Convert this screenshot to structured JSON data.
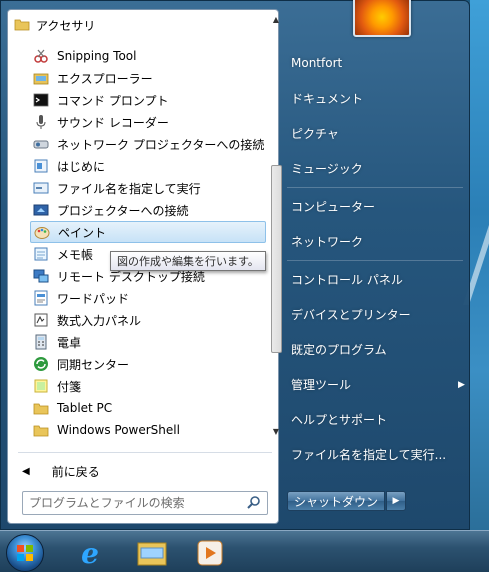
{
  "start_menu": {
    "folder_label": "アクセサリ",
    "programs": [
      {
        "label": "Snipping Tool",
        "icon": "snipping-tool-icon"
      },
      {
        "label": "エクスプローラー",
        "icon": "explorer-folder-icon"
      },
      {
        "label": "コマンド プロンプト",
        "icon": "command-prompt-icon"
      },
      {
        "label": "サウンド レコーダー",
        "icon": "microphone-icon"
      },
      {
        "label": "ネットワーク プロジェクターへの接続",
        "icon": "network-projector-icon"
      },
      {
        "label": "はじめに",
        "icon": "getting-started-icon"
      },
      {
        "label": "ファイル名を指定して実行",
        "icon": "run-icon"
      },
      {
        "label": "プロジェクターへの接続",
        "icon": "projector-icon"
      },
      {
        "label": "ペイント",
        "icon": "paint-icon"
      },
      {
        "label": "メモ帳",
        "icon": "notepad-icon"
      },
      {
        "label": "リモート デスクトップ接続",
        "icon": "remote-desktop-icon"
      },
      {
        "label": "ワードパッド",
        "icon": "wordpad-icon"
      },
      {
        "label": "数式入力パネル",
        "icon": "math-input-icon"
      },
      {
        "label": "電卓",
        "icon": "calculator-icon"
      },
      {
        "label": "同期センター",
        "icon": "sync-center-icon"
      },
      {
        "label": "付箋",
        "icon": "sticky-notes-icon"
      }
    ],
    "subfolders": [
      {
        "label": "Tablet PC",
        "icon": "folder-icon"
      },
      {
        "label": "Windows PowerShell",
        "icon": "folder-icon"
      }
    ],
    "selected_item": "ペイント",
    "tooltip": "図の作成や編集を行います。",
    "back_label": "前に戻る",
    "search_placeholder": "プログラムとファイルの検索"
  },
  "right_panel": {
    "items": [
      {
        "label": "Montfort"
      },
      {
        "label": "ドキュメント"
      },
      {
        "label": "ピクチャ"
      },
      {
        "label": "ミュージック"
      },
      {
        "label": "コンピューター"
      },
      {
        "label": "ネットワーク"
      },
      {
        "label": "コントロール パネル"
      },
      {
        "label": "デバイスとプリンター"
      },
      {
        "label": "既定のプログラム"
      },
      {
        "label": "管理ツール"
      },
      {
        "label": "ヘルプとサポート"
      },
      {
        "label": "ファイル名を指定して実行..."
      }
    ],
    "shutdown_label": "シャットダウン"
  },
  "taskbar": {
    "items": [
      {
        "icon": "start-orb-icon"
      },
      {
        "icon": "internet-explorer-icon"
      },
      {
        "icon": "explorer-icon"
      },
      {
        "icon": "media-player-icon"
      }
    ]
  },
  "colors": {
    "selection_bg": "#c7e2f7",
    "menu_right_bg": "#26567d",
    "taskbar_bg": "#2c5270"
  }
}
